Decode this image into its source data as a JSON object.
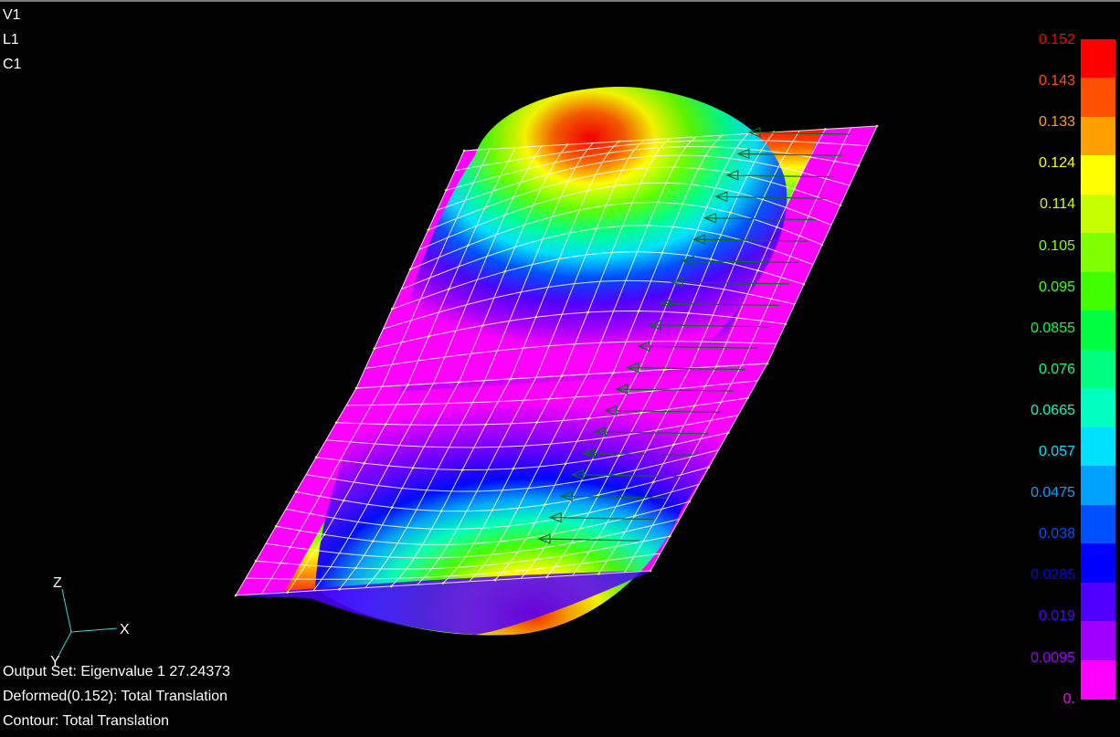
{
  "view_labels": [
    "V1",
    "L1",
    "C1"
  ],
  "status": {
    "output_set": "Output Set: Eigenvalue 1 27.24373",
    "deformed": "Deformed(0.152): Total Translation",
    "contour": "Contour: Total Translation"
  },
  "axes": {
    "z": "Z",
    "x": "X",
    "y": "Y"
  },
  "legend": {
    "levels": [
      {
        "label": "0.152",
        "color": "#ff0000"
      },
      {
        "label": "0.143",
        "color": "#ff5000"
      },
      {
        "label": "0.133",
        "color": "#ffa000"
      },
      {
        "label": "0.124",
        "color": "#ffff00"
      },
      {
        "label": "0.114",
        "color": "#c8ff00"
      },
      {
        "label": "0.105",
        "color": "#80ff00"
      },
      {
        "label": "0.095",
        "color": "#40ff00"
      },
      {
        "label": "0.0855",
        "color": "#00ff40"
      },
      {
        "label": "0.076",
        "color": "#00ff80"
      },
      {
        "label": "0.0665",
        "color": "#00ffc0"
      },
      {
        "label": "0.057",
        "color": "#00e0ff"
      },
      {
        "label": "0.0475",
        "color": "#00a0ff"
      },
      {
        "label": "0.038",
        "color": "#0050ff"
      },
      {
        "label": "0.0285",
        "color": "#0000ff"
      },
      {
        "label": "0.019",
        "color": "#5000ff"
      },
      {
        "label": "0.0095",
        "color": "#a000ff"
      },
      {
        "label": "0.",
        "color": "#ff00ff"
      }
    ]
  }
}
